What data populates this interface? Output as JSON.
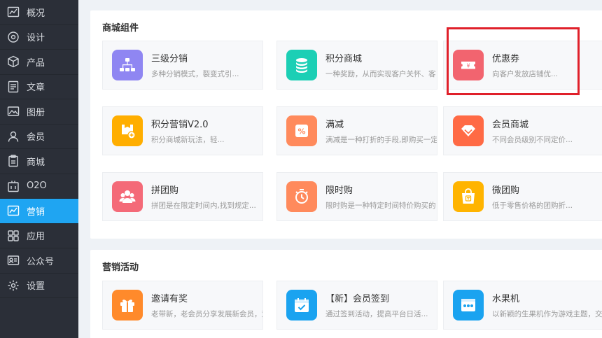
{
  "sidebar": {
    "items": [
      {
        "label": "概况",
        "icon": "overview-chart-icon"
      },
      {
        "label": "设计",
        "icon": "design-icon"
      },
      {
        "label": "产品",
        "icon": "product-box-icon"
      },
      {
        "label": "文章",
        "icon": "article-icon"
      },
      {
        "label": "图册",
        "icon": "gallery-icon"
      },
      {
        "label": "会员",
        "icon": "member-user-icon"
      },
      {
        "label": "商城",
        "icon": "mall-clipboard-icon"
      },
      {
        "label": "O2O",
        "icon": "o2o-store-icon"
      },
      {
        "label": "营销",
        "icon": "marketing-chart-icon",
        "active": true
      },
      {
        "label": "应用",
        "icon": "apps-grid-icon"
      },
      {
        "label": "公众号",
        "icon": "official-account-icon"
      },
      {
        "label": "设置",
        "icon": "settings-gear-icon"
      }
    ]
  },
  "mall_components": {
    "title": "商城组件",
    "cards": [
      {
        "title": "三级分销",
        "desc": "多种分销模式，裂变式引...",
        "icon": "distribution-tree-icon",
        "color": "#8f86f2"
      },
      {
        "title": "积分商城",
        "desc": "一种奖励，从而实现客户关怀、客",
        "icon": "points-coins-icon",
        "color": "#1ccfb5"
      },
      {
        "title": "优惠券",
        "desc": "向客户发放店铺优...",
        "icon": "coupon-ticket-icon",
        "color": "#f2646f"
      },
      {
        "title": "积分营销V2.0",
        "desc": "积分商城新玩法，轻...",
        "icon": "points-marketing-icon",
        "color": "#ffae00"
      },
      {
        "title": "满减",
        "desc": "满减是一种打折的手段,即购买一定",
        "icon": "discount-percent-icon",
        "color": "#ff8a5c"
      },
      {
        "title": "会员商城",
        "desc": "不同会员级别不同定价...",
        "icon": "member-diamond-icon",
        "color": "#ff6a45"
      },
      {
        "title": "拼团购",
        "desc": "拼团是在限定时间内,找到规定...",
        "icon": "group-buy-icon",
        "color": "#f46a78"
      },
      {
        "title": "限时购",
        "desc": "限时购是一种特定时间特价购买的",
        "icon": "timer-clock-icon",
        "color": "#ff8a5c"
      },
      {
        "title": "微团购",
        "desc": "低于零售价格的团购折...",
        "icon": "micro-group-bag-icon",
        "color": "#ffb400"
      }
    ]
  },
  "marketing_activities": {
    "title": "营销活动",
    "cards": [
      {
        "title": "邀请有奖",
        "desc": "老带新，老会员分享发展新会员，双",
        "icon": "gift-icon",
        "color": "#ff8a2b"
      },
      {
        "title": "【新】会员签到",
        "desc": "通过签到活动，提高平台日活...",
        "icon": "checkin-calendar-icon",
        "color": "#1aa3f0"
      },
      {
        "title": "水果机",
        "desc": "以新颖的生果机作为游戏主题，交",
        "icon": "fruit-machine-icon",
        "color": "#1aa3f0"
      }
    ]
  }
}
